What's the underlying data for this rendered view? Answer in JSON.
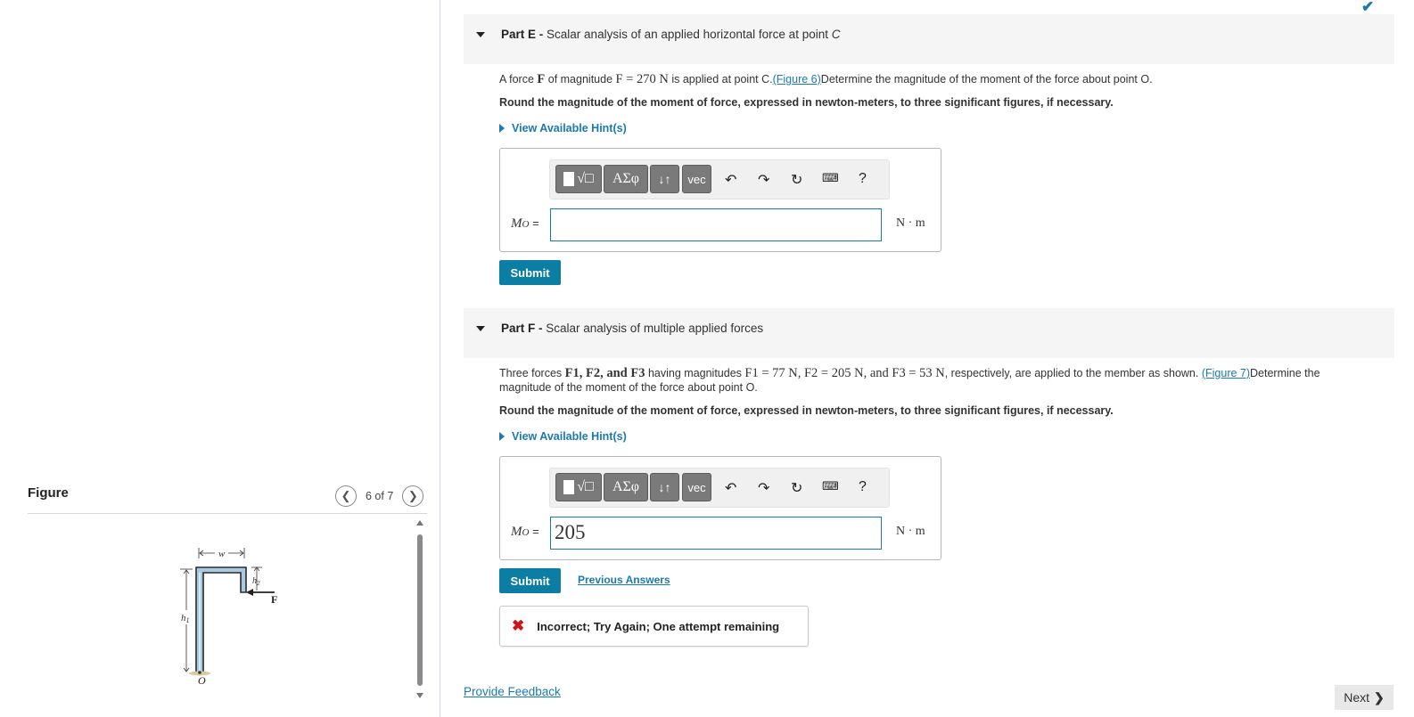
{
  "figure": {
    "title": "Figure",
    "counter": "6 of 7",
    "labels": {
      "w": "w",
      "h1": "h1",
      "h2": "h2",
      "F": "F",
      "O": "O"
    }
  },
  "partE": {
    "label": "Part E",
    "title": "Scalar analysis of an applied horizontal force at point",
    "title_point": "C",
    "q_prefix": "A force",
    "q_F": "F",
    "q_mid": "of magnitude",
    "q_eq": "F = 270 N",
    "q_mid2": "is applied at point C.",
    "q_link": "(Figure 6)",
    "q_suffix": "Determine the magnitude of the moment of the force about point O.",
    "round": "Round the magnitude of the moment of force, expressed in newton-meters, to three significant figures, if necessary.",
    "hints": "View Available Hint(s)",
    "answer_label": "M",
    "answer_sub": "O",
    "answer_eq": "=",
    "answer_value": "",
    "units": "N · m",
    "submit": "Submit"
  },
  "partF": {
    "label": "Part F",
    "title": "Scalar analysis of multiple applied forces",
    "q_prefix": "Three forces",
    "q_forces": "F1, F2, and F3",
    "q_mid": "having magnitudes",
    "q_mags": "F1 = 77 N, F2 = 205 N, and F3 = 53 N",
    "q_mid2": ", respectively, are applied to the member as shown.",
    "q_link": "(Figure 7)",
    "q_suffix": "Determine the",
    "q_line2": "magnitude of the moment of the force about point O.",
    "round": "Round the magnitude of the moment of force, expressed in newton-meters, to three significant figures, if necessary.",
    "hints": "View Available Hint(s)",
    "answer_label": "M",
    "answer_sub": "O",
    "answer_eq": "=",
    "answer_value": "205",
    "units": "N · m",
    "submit": "Submit",
    "previous_answers": "Previous Answers",
    "feedback": "Incorrect; Try Again; One attempt remaining"
  },
  "toolbar": {
    "greek": "ΑΣφ",
    "arrows": "↓↑",
    "vec": "vec",
    "help": "?"
  },
  "footer": {
    "provide_feedback": "Provide Feedback",
    "next": "Next"
  },
  "icons": [
    "undo-icon",
    "redo-icon",
    "reset-icon",
    "keyboard-icon",
    "help-icon",
    "check-icon",
    "x-icon"
  ],
  "colors": {
    "accent": "#0d7ea3",
    "link": "#1a7ab0",
    "error": "#d0121b"
  }
}
